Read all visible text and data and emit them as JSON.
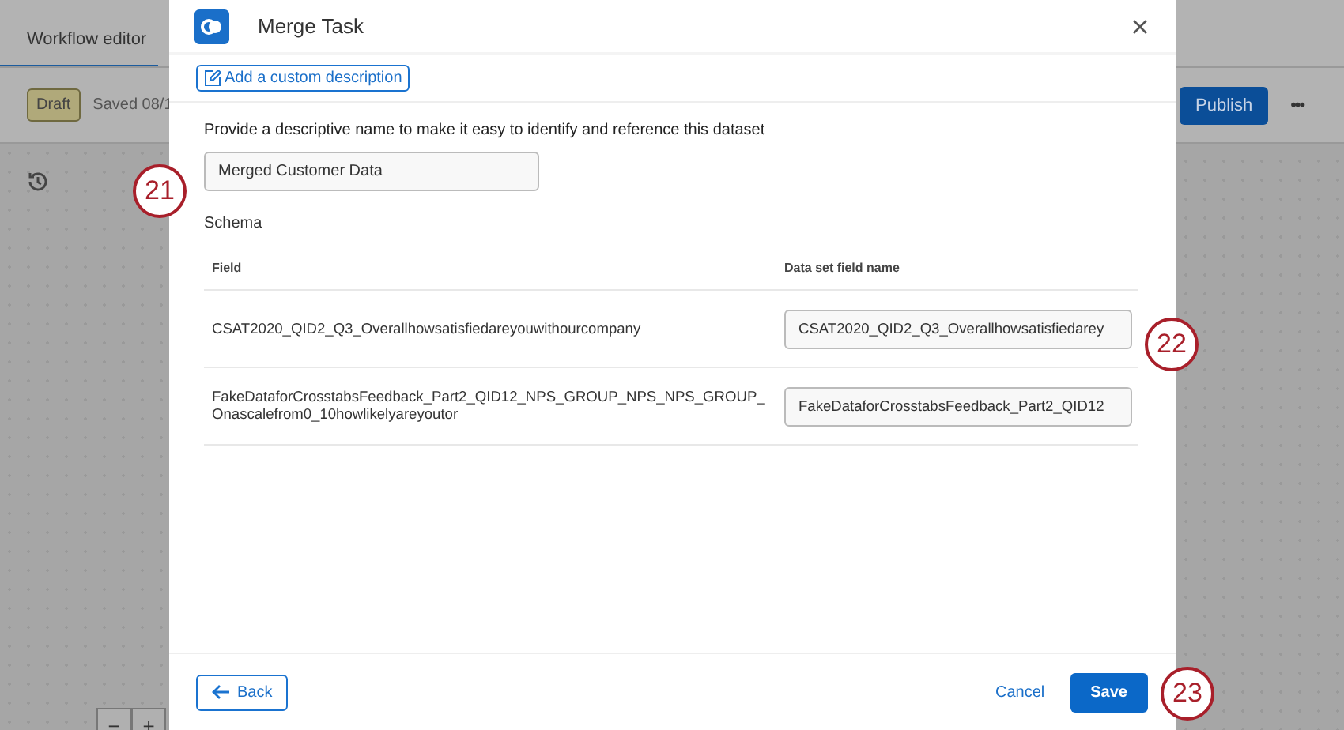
{
  "background": {
    "tab": "Workflow editor",
    "status_badge": "Draft",
    "saved_text": "Saved 08/1",
    "publish_button": "Publish",
    "more_button": "•••",
    "zoom_controls": [
      "−",
      "+"
    ]
  },
  "dialog": {
    "title": "Merge Task",
    "description_button": "Add a custom description",
    "name_label": "Provide a descriptive name to make it easy to identify and reference this dataset",
    "name_value": "Merged Customer Data",
    "schema_title": "Schema",
    "columns": [
      "Field",
      "Data set field name"
    ],
    "rows": [
      {
        "field": "CSAT2020_QID2_Q3_Overallhowsatisfiedareyouwithourcompany",
        "name_value": "CSAT2020_QID2_Q3_Overallhowsatisfiedarey"
      },
      {
        "field": "FakeDataforCrosstabsFeedback_Part2_QID12_NPS_GROUP_NPS_NPS_GROUP_Onascalefrom0_10howlikelyareyoutor",
        "name_value": "FakeDataforCrosstabsFeedback_Part2_QID12"
      }
    ],
    "back_button": "Back",
    "cancel_button": "Cancel",
    "save_button": "Save"
  },
  "callouts": [
    "21",
    "22",
    "23"
  ]
}
